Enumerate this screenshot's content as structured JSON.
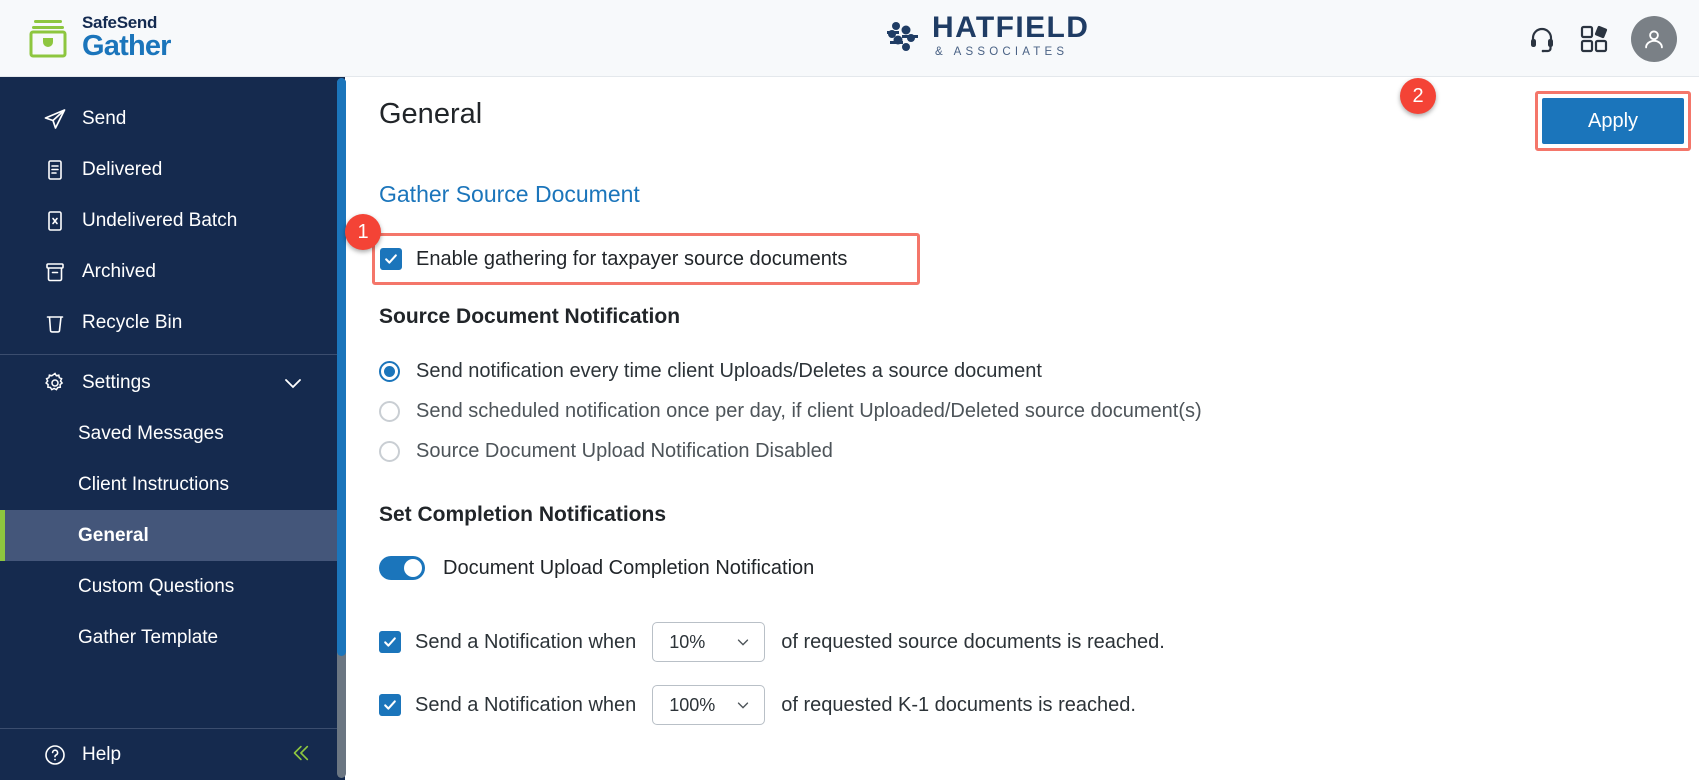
{
  "header": {
    "brand": {
      "top": "SafeSend",
      "bottom": "Gather",
      "mark_icon": "archive-box-icon"
    },
    "firm": {
      "name": "HATFIELD",
      "tagline": "& ASSOCIATES",
      "mark_icon": "hatfield-nodes-icon"
    },
    "actions": [
      {
        "name": "support-headset-icon",
        "label": "Support"
      },
      {
        "name": "apps-grid-icon",
        "label": "Apps"
      },
      {
        "name": "user-avatar",
        "label": "Account"
      }
    ]
  },
  "sidebar": {
    "items": [
      {
        "label": "Send",
        "icon": "send-paper-plane-icon"
      },
      {
        "label": "Delivered",
        "icon": "document-lines-icon"
      },
      {
        "label": "Undelivered Batch",
        "icon": "document-x-icon"
      },
      {
        "label": "Archived",
        "icon": "archive-icon"
      },
      {
        "label": "Recycle Bin",
        "icon": "trash-icon"
      }
    ],
    "settings": {
      "label": "Settings",
      "icon": "gear-icon",
      "caret": "chevron-down-icon"
    },
    "settings_children": [
      {
        "label": "Saved Messages",
        "active": false
      },
      {
        "label": "Client Instructions",
        "active": false
      },
      {
        "label": "General",
        "active": true
      },
      {
        "label": "Custom Questions",
        "active": false
      },
      {
        "label": "Gather Template",
        "active": false
      }
    ],
    "help": {
      "label": "Help",
      "icon": "question-circle-icon",
      "collapse_icon": "chevron-double-left-icon"
    }
  },
  "main": {
    "page_title": "General",
    "apply_label": "Apply",
    "section_link": "Gather Source Document",
    "enable_checkbox": {
      "label": "Enable gathering for taxpayer source documents",
      "checked": true
    },
    "source_doc_notification": {
      "heading": "Source Document Notification",
      "options": [
        {
          "label": "Send notification every time client Uploads/Deletes a source document",
          "selected": true
        },
        {
          "label": "Send scheduled notification once per day, if client Uploaded/Deleted source document(s)",
          "selected": false
        },
        {
          "label": "Source Document Upload Notification Disabled",
          "selected": false
        }
      ]
    },
    "completion_notifications": {
      "heading": "Set Completion Notifications",
      "toggle": {
        "label": "Document Upload Completion Notification",
        "on": true
      },
      "rows": [
        {
          "checked": true,
          "prefix": "Send a Notification when",
          "value": "10%",
          "suffix": "of requested source documents is reached.",
          "chevron": "chevron-down-icon"
        },
        {
          "checked": true,
          "prefix": "Send a Notification when",
          "value": "100%",
          "suffix": "of requested K-1 documents is reached.",
          "chevron": "chevron-down-icon"
        }
      ]
    }
  },
  "annotations": [
    {
      "number": "1",
      "target": "enable-gathering-checkbox"
    },
    {
      "number": "2",
      "target": "apply-button"
    }
  ],
  "colors": {
    "sidebar_bg": "#152a4e",
    "sidebar_active": "#44567a",
    "accent_green": "#8dc63f",
    "accent_blue": "#1b75bb",
    "badge_red": "#f44336",
    "highlight_red": "#f4766a"
  }
}
